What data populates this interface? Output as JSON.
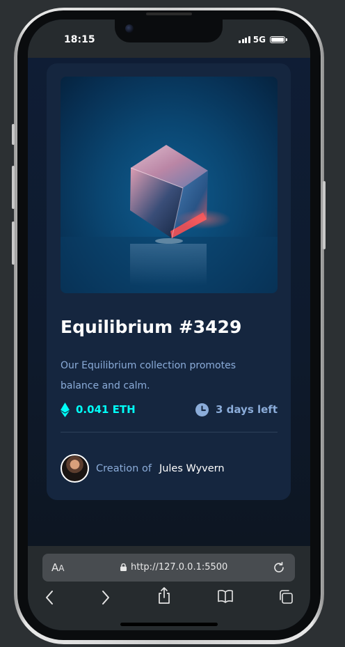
{
  "status_bar": {
    "time": "18:15",
    "network": "5G"
  },
  "nft_card": {
    "title": "Equilibrium #3429",
    "description": "Our Equilibrium collection promotes balance and calm.",
    "price": "0.041 ETH",
    "time_left": "3 days left",
    "creation_label": "Creation of",
    "creator_name": "Jules Wyvern"
  },
  "browser": {
    "text_size_label_large": "A",
    "text_size_label_small": "A",
    "url": "http://127.0.0.1:5500"
  },
  "colors": {
    "accent_cyan": "#00fff8",
    "soft_blue": "#8bacd9",
    "card_bg": "#15263f",
    "page_bg": "#0d1622"
  }
}
